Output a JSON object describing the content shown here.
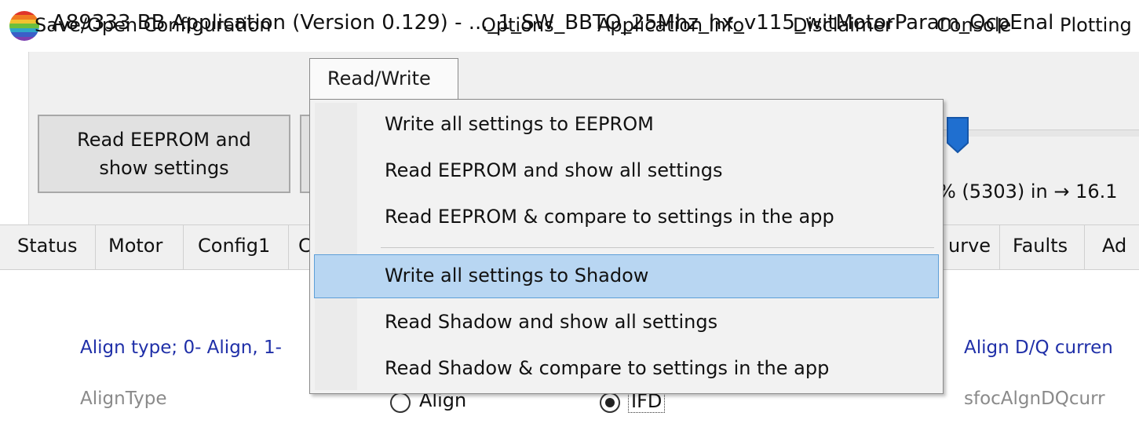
{
  "window": {
    "title": "A89333 BB Application (Version 0.129)  -  ..._1_SW_BBTO_25Mhz_hx_v115_witMotorParam_OcpEnal"
  },
  "menubar": {
    "items": [
      {
        "label": "Save/Open Configuration"
      },
      {
        "label": "Read/Write"
      },
      {
        "label": "Options"
      },
      {
        "label": "Application Info"
      },
      {
        "label": "Disclaimer"
      },
      {
        "label": "Console"
      },
      {
        "label": "Plotting"
      }
    ]
  },
  "toolbar": {
    "read_button_line1": "Read EEPROM and",
    "read_button_line2": "show settings",
    "speed_readout": "% (5303) in → 16.1"
  },
  "tabs": [
    {
      "label": "Status"
    },
    {
      "label": "Motor"
    },
    {
      "label": "Config1"
    },
    {
      "label": "C"
    },
    {
      "label": "urve"
    },
    {
      "label": "Faults"
    },
    {
      "label": "Ad"
    }
  ],
  "content": {
    "align_type_label": "Align type; 0- Align, 1-",
    "align_type_param": "AlignType",
    "align_dq_label": "Align D/Q curren",
    "align_dq_param": "sfocAlgnDQcurr",
    "radio_align_label": "Align",
    "radio_ifd_label": "IFD",
    "radio_selected": "IFD"
  },
  "dropdown": {
    "items": [
      {
        "label": "Write all settings to EEPROM"
      },
      {
        "label": "Read EEPROM and show all settings"
      },
      {
        "label": "Read EEPROM & compare to settings in the app"
      },
      {
        "label": "Write all settings to Shadow"
      },
      {
        "label": "Read Shadow and show all settings"
      },
      {
        "label": "Read Shadow & compare to settings in the app"
      }
    ],
    "highlighted": "Write all settings to Shadow"
  },
  "colors": {
    "menu_background": "#f0f0f0",
    "highlight_fill": "#b8d6f2",
    "highlight_border": "#5d9fd8",
    "label_blue": "#1f2fa8",
    "slider_thumb": "#1f6fd0"
  },
  "icons": {
    "app": "rainbow-globe-icon",
    "slider": "slider-thumb-icon"
  }
}
